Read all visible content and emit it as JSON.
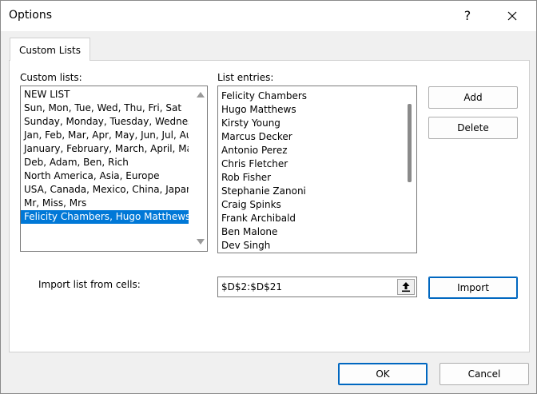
{
  "window": {
    "title": "Options",
    "help_label": "?"
  },
  "tabs": [
    {
      "label": "Custom Lists"
    }
  ],
  "custom_lists": {
    "label": "Custom lists:",
    "items": [
      "NEW LIST",
      "Sun, Mon, Tue, Wed, Thu, Fri, Sat",
      "Sunday, Monday, Tuesday, Wednesday",
      "Jan, Feb, Mar, Apr, May, Jun, Jul, Aug",
      "January, February, March, April, May",
      "Deb, Adam, Ben, Rich",
      "North America, Asia, Europe",
      "USA, Canada, Mexico, China, Japan,",
      "Mr, Miss, Mrs",
      "Felicity Chambers, Hugo Matthews,"
    ],
    "selected_index": 9
  },
  "list_entries": {
    "label": "List entries:",
    "items": [
      "Felicity Chambers",
      "Hugo Matthews",
      "Kirsty Young",
      "Marcus Decker",
      "Antonio Perez",
      "Chris Fletcher",
      "Rob Fisher",
      "Stephanie Zanoni",
      "Craig Spinks",
      "Frank Archibald",
      "Ben Malone",
      "Dev Singh"
    ]
  },
  "buttons": {
    "add": "Add",
    "delete": "Delete",
    "import": "Import",
    "ok": "OK",
    "cancel": "Cancel"
  },
  "import": {
    "label": "Import list from cells:",
    "value": "$D$2:$D$21"
  },
  "icons": {
    "close": "close-icon",
    "collapse": "collapse-dialog-icon"
  }
}
